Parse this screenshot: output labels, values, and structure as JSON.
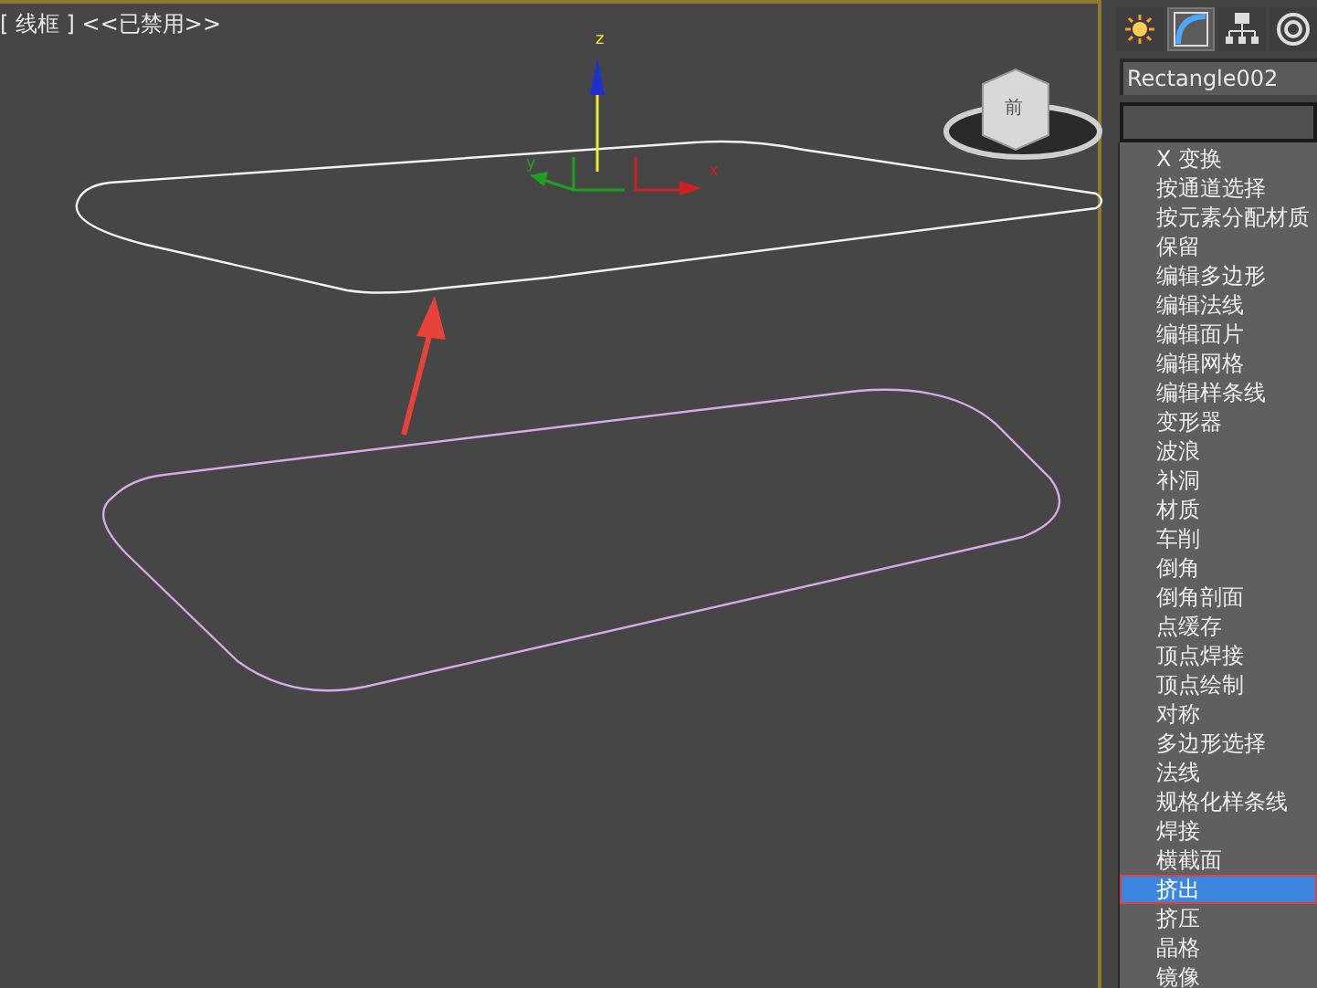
{
  "viewport": {
    "label": "[ 线框 ] <<已禁用>>",
    "gizmo": {
      "z": "z",
      "y": "y",
      "x": "x"
    },
    "viewcube": {
      "face": "前"
    }
  },
  "command_panel": {
    "tabs": [
      {
        "kind": "create",
        "selected": false
      },
      {
        "kind": "modify",
        "selected": true
      },
      {
        "kind": "hierarchy",
        "selected": false
      },
      {
        "kind": "motion",
        "selected": false
      }
    ],
    "object_name": "Rectangle002",
    "modifier_list": [
      {
        "label": "X 变换",
        "selected": false
      },
      {
        "label": "按通道选择",
        "selected": false
      },
      {
        "label": "按元素分配材质",
        "selected": false
      },
      {
        "label": "保留",
        "selected": false
      },
      {
        "label": "编辑多边形",
        "selected": false
      },
      {
        "label": "编辑法线",
        "selected": false
      },
      {
        "label": "编辑面片",
        "selected": false
      },
      {
        "label": "编辑网格",
        "selected": false
      },
      {
        "label": "编辑样条线",
        "selected": false
      },
      {
        "label": "变形器",
        "selected": false
      },
      {
        "label": "波浪",
        "selected": false
      },
      {
        "label": "补洞",
        "selected": false
      },
      {
        "label": "材质",
        "selected": false
      },
      {
        "label": "车削",
        "selected": false
      },
      {
        "label": "倒角",
        "selected": false
      },
      {
        "label": "倒角剖面",
        "selected": false
      },
      {
        "label": "点缓存",
        "selected": false
      },
      {
        "label": "顶点焊接",
        "selected": false
      },
      {
        "label": "顶点绘制",
        "selected": false
      },
      {
        "label": "对称",
        "selected": false
      },
      {
        "label": "多边形选择",
        "selected": false
      },
      {
        "label": "法线",
        "selected": false
      },
      {
        "label": "规格化样条线",
        "selected": false
      },
      {
        "label": "焊接",
        "selected": false
      },
      {
        "label": "横截面",
        "selected": false
      },
      {
        "label": "挤出",
        "selected": true
      },
      {
        "label": "挤压",
        "selected": false
      },
      {
        "label": "晶格",
        "selected": false
      },
      {
        "label": "镜像",
        "selected": false
      }
    ]
  }
}
